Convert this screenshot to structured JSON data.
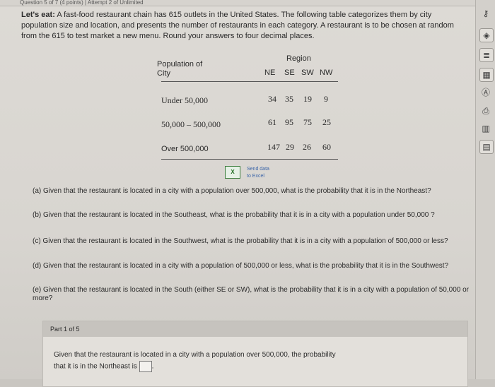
{
  "header": {
    "text": "Question 5 of 7 (4 points) | Attempt 2 of Unlimited"
  },
  "problem": {
    "lead": "Let's eat:",
    "text": "A fast-food restaurant chain has 615 outlets in the United States. The following table categorizes them by city population size and location, and presents the number of restaurants in each category. A restaurant is to be chosen at random from the 615 to test market a new menu. Round your answers to four decimal places."
  },
  "table": {
    "region_header": "Region",
    "row_header": "Population of City",
    "columns": [
      "NE",
      "SE",
      "SW",
      "NW"
    ],
    "rows": [
      {
        "label": "Under 50,000",
        "values": [
          "34",
          "35",
          "19",
          "9"
        ]
      },
      {
        "label": "50,000 – 500,000",
        "values": [
          "61",
          "95",
          "75",
          "25"
        ]
      },
      {
        "label": "Over 500,000",
        "values": [
          "147",
          "29",
          "26",
          "60"
        ]
      }
    ]
  },
  "excel": {
    "icon_text": "X",
    "line1": "Send data",
    "line2": "to Excel"
  },
  "questions": {
    "a": "(a) Given that the restaurant is located in a city with a population over 500,000, what is the probability that it is in the Northeast?",
    "b": "(b) Given that the restaurant is located in the Southeast, what is the probability that it is in a city with a population under 50,000 ?",
    "c": "(c) Given that the restaurant is located in the Southwest, what is the probability that it is in a city with a population of 500,000 or less?",
    "d": "(d) Given that the restaurant is located in a city with a population of 500,000 or less, what is the probability that it is in the Southwest?",
    "e": "(e) Given that the restaurant is located in the South (either SE or SW), what is the probability that it is in a city with a population of 50,000 or more?"
  },
  "part": {
    "title": "Part 1 of 5",
    "prompt_line1": "Given that the restaurant is located in a city with a population over 500,000, the probability",
    "prompt_line2": "that it is in the Northeast is",
    "answer_value": ""
  },
  "sidebar": {
    "icons": [
      "key-icon",
      "hint-icon",
      "text-icon",
      "calculator-icon",
      "glossary-icon",
      "print-icon",
      "chart-icon",
      "book-icon"
    ]
  }
}
